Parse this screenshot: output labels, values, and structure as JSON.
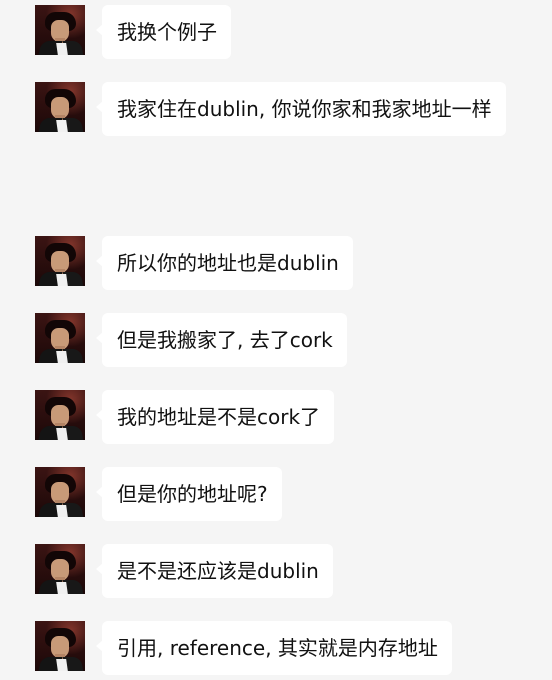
{
  "chat": {
    "messages": [
      {
        "text": "我换个例子"
      },
      {
        "text": "我家住在dublin, 你说你家和我家地址一样"
      },
      {
        "text": "所以你的地址也是dublin"
      },
      {
        "text": "但是我搬家了, 去了cork"
      },
      {
        "text": "我的地址是不是cork了"
      },
      {
        "text": "但是你的地址呢?"
      },
      {
        "text": "是不是还应该是dublin"
      },
      {
        "text": "引用, reference, 其实就是内存地址"
      }
    ]
  }
}
